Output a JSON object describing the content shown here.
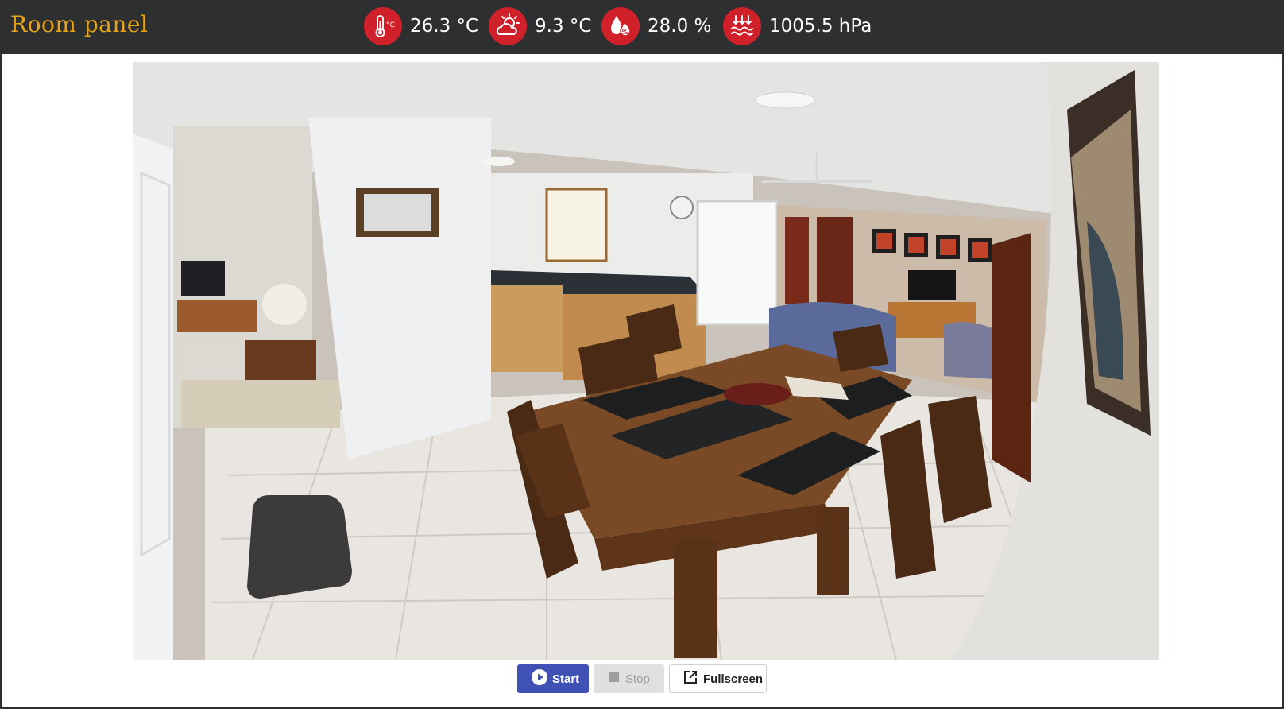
{
  "app": {
    "title": "Room panel"
  },
  "sensors": [
    {
      "icon": "thermometer-celsius-icon",
      "value": "26.3 °C"
    },
    {
      "icon": "sun-cloud-weather-icon",
      "value": "9.3 °C"
    },
    {
      "icon": "humidity-drop-icon",
      "value": "28.0 %"
    },
    {
      "icon": "pressure-arrows-icon",
      "value": "1005.5 hPa"
    }
  ],
  "camera": {
    "scene": "living-dining-room-fisheye-view"
  },
  "controls": {
    "start_label": "Start",
    "stop_label": "Stop",
    "fullscreen_label": "Fullscreen"
  },
  "colors": {
    "topbar": "#2d2f31",
    "title": "#e8a317",
    "sensor_icon_bg": "#d0202a",
    "primary": "#3f51b5"
  }
}
